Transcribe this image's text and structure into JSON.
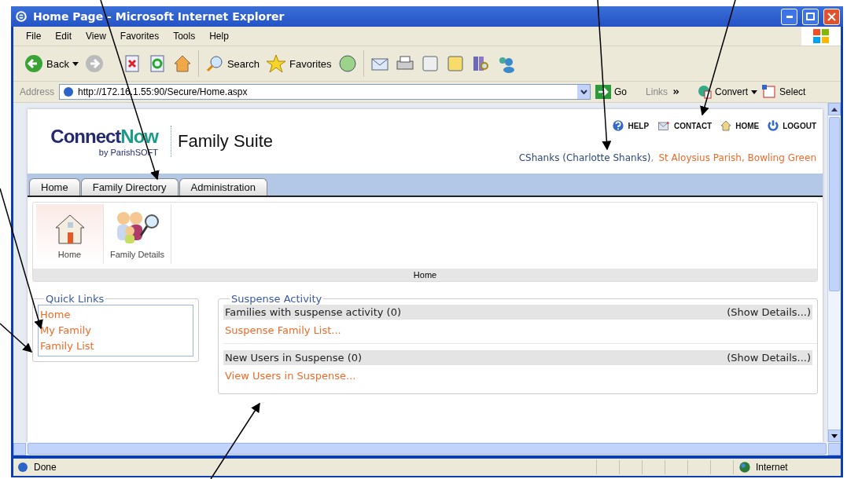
{
  "window": {
    "title": "Home Page - Microsoft Internet Explorer"
  },
  "menu": [
    "File",
    "Edit",
    "View",
    "Favorites",
    "Tools",
    "Help"
  ],
  "toolbar": {
    "back": "Back",
    "search": "Search",
    "favorites": "Favorites"
  },
  "address": {
    "label": "Address",
    "value": "http://172.16.1.55:90/Secure/Home.aspx",
    "go": "Go",
    "links": "Links",
    "convert": "Convert",
    "select": "Select"
  },
  "site": {
    "logo_main": "Connect",
    "logo_accent": "Now",
    "logo_by": "by ParishSOFT",
    "suite": "Family Suite",
    "top_links": [
      {
        "kind": "help",
        "label": "HELP"
      },
      {
        "kind": "contact",
        "label": "CONTACT"
      },
      {
        "kind": "home",
        "label": "HOME"
      },
      {
        "kind": "logout",
        "label": "LOGOUT"
      }
    ],
    "user": "CShanks (Charlotte Shanks)",
    "separator": ",",
    "parish": "St Aloysius Parish, Bowling Green"
  },
  "tabs": [
    "Home",
    "Family Directory",
    "Administration"
  ],
  "ribbon": {
    "items": [
      {
        "kind": "home",
        "label": "Home",
        "selected": true
      },
      {
        "kind": "family",
        "label": "Family Details",
        "selected": false
      }
    ],
    "caption": "Home"
  },
  "quick_links": {
    "title": "Quick Links",
    "items": [
      "Home",
      "My Family",
      "Family List"
    ]
  },
  "suspense": {
    "title": "Suspense Activity",
    "sections": [
      {
        "heading": "Families with suspense activity (0)",
        "details": "(Show Details...)",
        "link": "Suspense Family List..."
      },
      {
        "heading": "New Users in Suspense (0)",
        "details": "(Show Details...)",
        "link": "View Users in Suspense..."
      }
    ]
  },
  "status_bar": {
    "text": "Done",
    "zone": "Internet"
  }
}
